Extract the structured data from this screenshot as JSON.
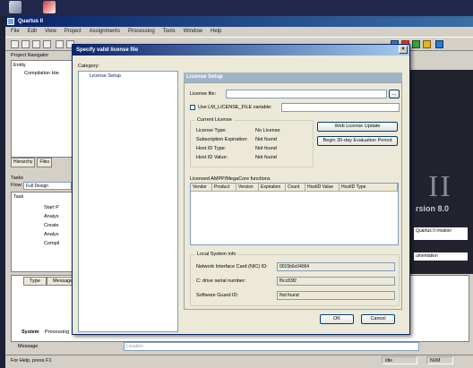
{
  "app": {
    "title": "Quartus II",
    "menu": [
      "File",
      "Edit",
      "View",
      "Project",
      "Assignments",
      "Processing",
      "Tools",
      "Window",
      "Help"
    ]
  },
  "left": {
    "navigator_label": "Project Navigator",
    "entity_header": "Entity",
    "compilation_item": "Compilation Hie",
    "tabs": [
      "Hierarchy",
      "Files"
    ],
    "tasks_label": "Tasks",
    "flow_label": "Flow:",
    "flow_value": "Full Design",
    "task_header": "Task",
    "task_items": [
      "Start P",
      "Analys",
      "Create",
      "Analys",
      "Compil"
    ]
  },
  "messages": {
    "columns": [
      "Type",
      "Message"
    ],
    "tabs": [
      "System",
      "Processing"
    ],
    "label": "Message",
    "location_placeholder": "Location"
  },
  "splash": {
    "roman": "II",
    "version": "rsion 8.0",
    "link1": "Quartus II\nrmation",
    "link2": "umentation"
  },
  "statusbar": {
    "help_text": "For Help, press F1",
    "idle": "Idle",
    "num": "NUM"
  },
  "dialog": {
    "title": "Specify valid license file",
    "close_glyph": "×",
    "category_label": "Category:",
    "category_item": "License Setup",
    "section_header": "License Setup",
    "license_file_label": "License file:",
    "license_file_value": "",
    "browse_label": "...",
    "use_lm_label": "Use LM_LICENSE_FILE variable:",
    "use_lm_checked": false,
    "current_license": {
      "title": "Current License",
      "rows": [
        {
          "label": "License Type:",
          "value": "No License"
        },
        {
          "label": "Subscription Expiration:",
          "value": "Not found"
        },
        {
          "label": "Host ID Type:",
          "value": "Not found"
        },
        {
          "label": "Host ID Value:",
          "value": "Not found"
        }
      ]
    },
    "web_update_button": "Web License Update",
    "eval_button": "Begin 30-day Evaluation Period",
    "functions": {
      "title": "Licensed AMPP/MegaCore functions",
      "columns": [
        "Vendor",
        "Product",
        "Version",
        "Expiration",
        "Count",
        "HostID Value",
        "HostID Type"
      ]
    },
    "local_info": {
      "title": "Local System info",
      "rows": [
        {
          "label": "Network Interface Card (NIC) ID:",
          "value": "0015b6c04064"
        },
        {
          "label": "C: drive serial number:",
          "value": "f6cc83f2"
        },
        {
          "label": "Software Guard ID:",
          "value": "Not found"
        }
      ]
    },
    "ok_button": "OK",
    "cancel_button": "Cancel"
  }
}
